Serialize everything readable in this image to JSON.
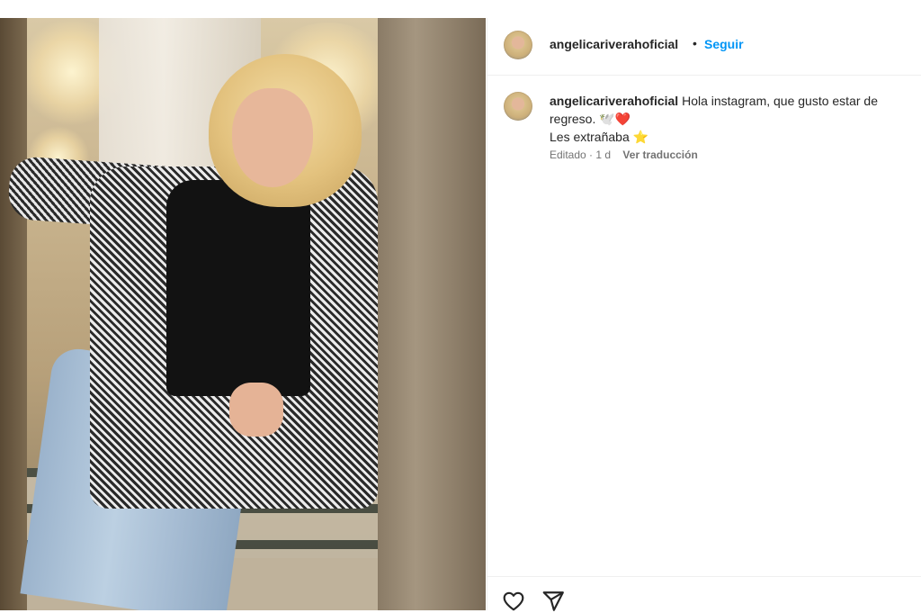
{
  "post": {
    "username": "angelicariverahoficial",
    "separator": "•",
    "follow_label": "Seguir",
    "caption": {
      "username": "angelicariverahoficial",
      "line1": "Hola instagram, que gusto estar de regreso. 🕊️❤️",
      "line2": "Les extrañaba ⭐",
      "edited_label": "Editado",
      "time_sep": "·",
      "time": "1 d",
      "translate_label": "Ver traducción"
    },
    "icons": {
      "avatar": "profile-avatar",
      "like": "heart-icon",
      "share": "paper-plane-icon"
    },
    "colors": {
      "accent": "#0095f6",
      "text": "#262626",
      "muted": "#737373",
      "divider": "#efefef"
    }
  }
}
